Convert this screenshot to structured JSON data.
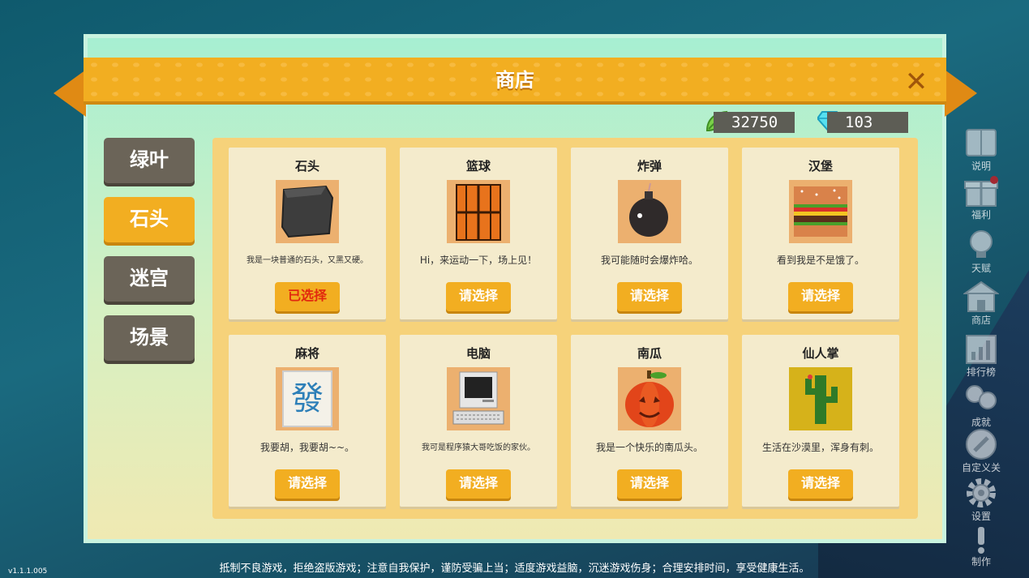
{
  "shop": {
    "title": "商店",
    "close_icon": "close-x-icon",
    "currency": {
      "leaves": "32750",
      "diamonds": "103"
    },
    "categories": [
      {
        "label": "绿叶",
        "active": false
      },
      {
        "label": "石头",
        "active": true
      },
      {
        "label": "迷宫",
        "active": false
      },
      {
        "label": "场景",
        "active": false
      }
    ],
    "items": [
      {
        "name": "石头",
        "desc": "我是一块普通的石头，又黑又硬。",
        "button": "已选择",
        "icon": "stone-icon"
      },
      {
        "name": "篮球",
        "desc": "Hi，来运动一下，场上见！",
        "button": "请选择",
        "icon": "basketball-icon"
      },
      {
        "name": "炸弹",
        "desc": "我可能随时会爆炸哈。",
        "button": "请选择",
        "icon": "bomb-icon"
      },
      {
        "name": "汉堡",
        "desc": "看到我是不是饿了。",
        "button": "请选择",
        "icon": "burger-icon"
      },
      {
        "name": "麻将",
        "desc": "我要胡，我要胡~~。",
        "button": "请选择",
        "icon": "mahjong-icon"
      },
      {
        "name": "电脑",
        "desc": "我可是程序猿大哥吃饭的家伙。",
        "button": "请选择",
        "icon": "computer-icon"
      },
      {
        "name": "南瓜",
        "desc": "我是一个快乐的南瓜头。",
        "button": "请选择",
        "icon": "pumpkin-icon"
      },
      {
        "name": "仙人掌",
        "desc": "生活在沙漠里，浑身有刺。",
        "button": "请选择",
        "icon": "cactus-icon"
      }
    ],
    "mahjong_glyph": "發"
  },
  "side_menu": [
    {
      "label": "说明",
      "icon": "book-icon"
    },
    {
      "label": "福利",
      "icon": "gift-icon"
    },
    {
      "label": "天赋",
      "icon": "bulb-icon"
    },
    {
      "label": "商店",
      "icon": "shop-icon"
    },
    {
      "label": "排行榜",
      "icon": "chart-icon"
    },
    {
      "label": "成就",
      "icon": "medal-icon"
    },
    {
      "label": "自定义关",
      "icon": "pencil-icon"
    },
    {
      "label": "设置",
      "icon": "gear-icon"
    },
    {
      "label": "制作",
      "icon": "exclamation-icon"
    }
  ],
  "footer": "抵制不良游戏，拒绝盗版游戏；注意自我保护，谨防受骗上当；适度游戏益脑，沉迷游戏伤身；合理安排时间，享受健康生活。",
  "version": "v1.1.1.005"
}
